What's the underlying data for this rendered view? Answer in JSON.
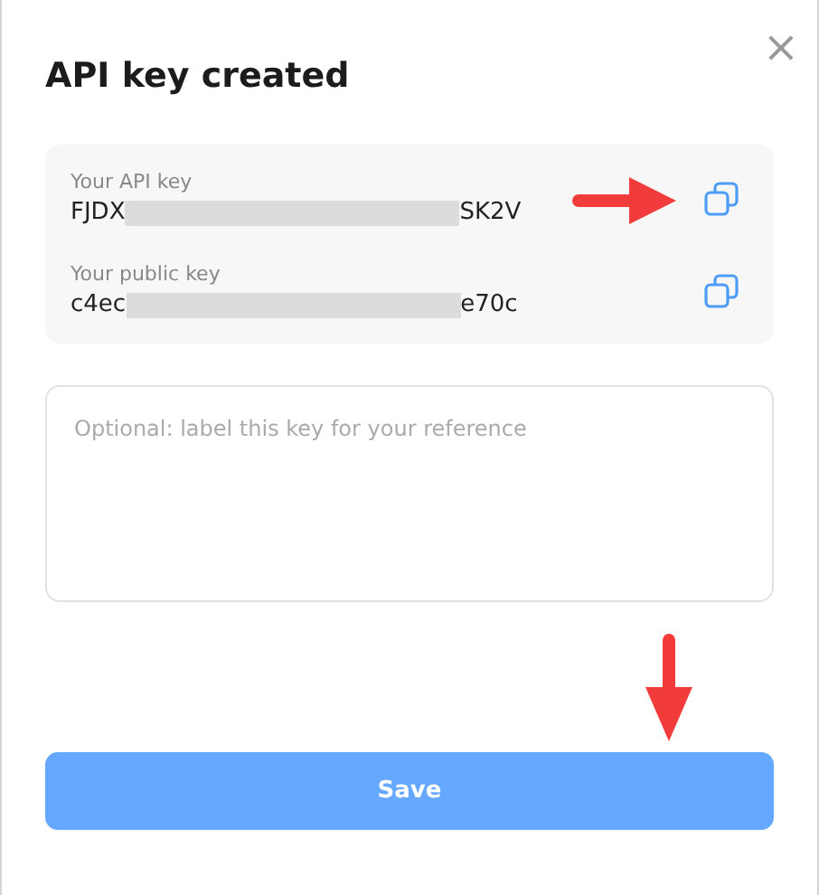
{
  "dialog": {
    "title": "API key created",
    "close": "×"
  },
  "keys": [
    {
      "label": "Your API key",
      "value_start": "FJDX",
      "value_end": "SK2V",
      "redacted": true,
      "arrow": true
    },
    {
      "label": "Your public key",
      "value_start": "c4ec",
      "value_end": "e70c",
      "redacted": true,
      "arrow": false
    }
  ],
  "note_field": {
    "placeholder": "Optional: label this key for your reference"
  },
  "save_button": {
    "label": "Save",
    "arrow": true
  }
}
